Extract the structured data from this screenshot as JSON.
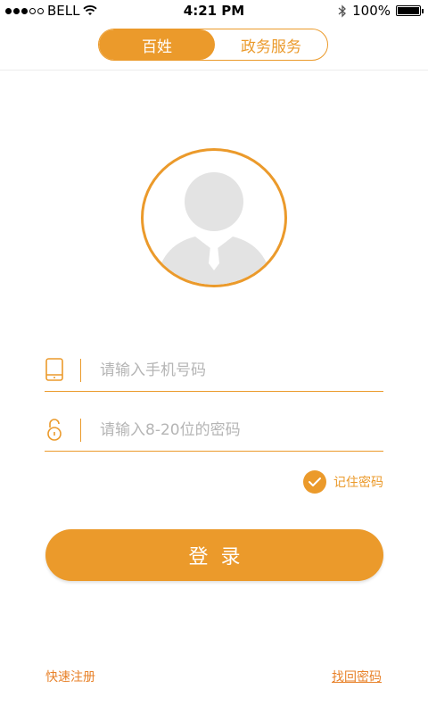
{
  "status_bar": {
    "carrier": "BELL",
    "time": "4:21 PM",
    "battery": "100%"
  },
  "tabs": [
    {
      "label": "百姓",
      "active": true
    },
    {
      "label": "政务服务",
      "active": false
    }
  ],
  "avatar": {
    "icon": "user-avatar-icon"
  },
  "form": {
    "phone_placeholder": "请输入手机号码",
    "password_placeholder": "请输入8-20位的密码",
    "phone_icon": "tablet-icon",
    "password_icon": "unlock-icon",
    "remember_label": "记住密码",
    "remember_checked": true
  },
  "login_label": "登录",
  "links": {
    "register": "快速注册",
    "recover": "找回密码"
  },
  "colors": {
    "accent": "#eb9a2b",
    "link": "#e8822a",
    "avatar_gray": "#e3e3e3"
  }
}
